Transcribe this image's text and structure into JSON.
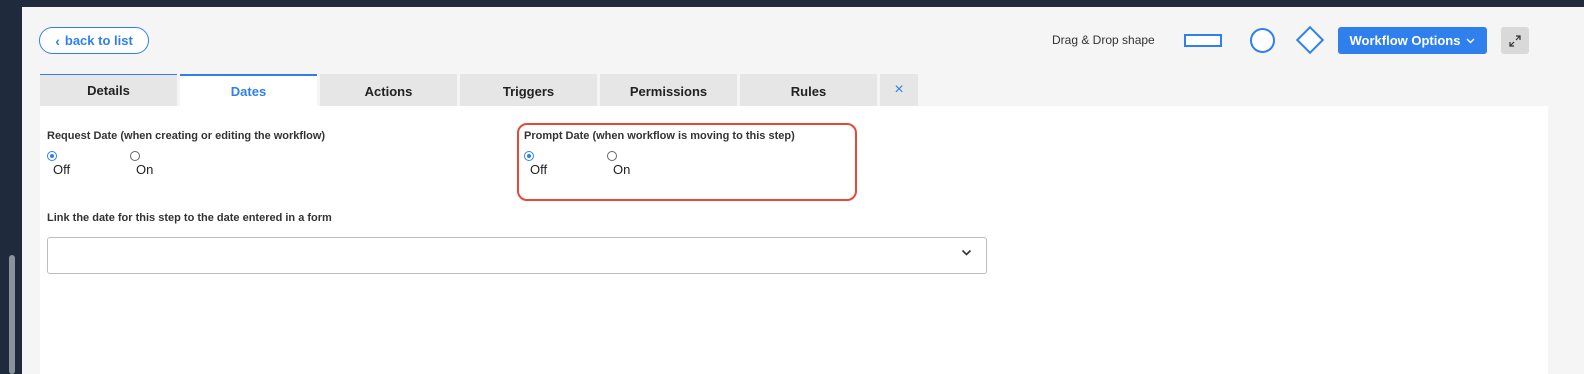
{
  "header": {
    "back_label": "back to list",
    "dnd_label": "Drag & Drop shape",
    "workflow_options_label": "Workflow Options"
  },
  "tabs": [
    {
      "label": "Details"
    },
    {
      "label": "Dates",
      "active": true
    },
    {
      "label": "Actions"
    },
    {
      "label": "Triggers"
    },
    {
      "label": "Permissions"
    },
    {
      "label": "Rules"
    }
  ],
  "close_tab_label": "×",
  "request_date": {
    "label": "Request Date (when creating or editing the workflow)",
    "options": [
      {
        "label": "Off",
        "checked": true
      },
      {
        "label": "On",
        "checked": false
      }
    ]
  },
  "prompt_date": {
    "label": "Prompt Date (when workflow is moving to this step)",
    "options": [
      {
        "label": "Off",
        "checked": true
      },
      {
        "label": "On",
        "checked": false
      }
    ]
  },
  "link_date": {
    "label": "Link the date for this step to the date entered in a form",
    "value": ""
  },
  "colors": {
    "accent": "#2f80ed",
    "highlight": "#e34b35"
  }
}
